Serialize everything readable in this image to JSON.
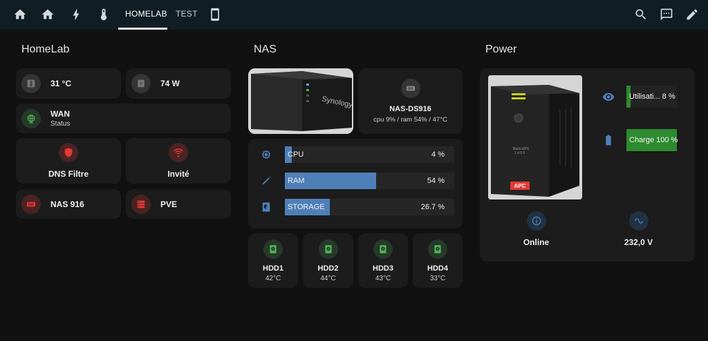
{
  "nav": {
    "tabs": [
      {
        "icon": "home-icon"
      },
      {
        "icon": "home-icon"
      },
      {
        "icon": "lightning-icon"
      },
      {
        "icon": "thermometer-icon"
      },
      {
        "label": "HOMELAB",
        "active": true
      },
      {
        "label": "TEST"
      },
      {
        "icon": "tablet-icon"
      }
    ],
    "actions": [
      "search-icon",
      "chat-icon",
      "edit-icon"
    ]
  },
  "homelab": {
    "title": "HomeLab",
    "temperature": "31 °C",
    "power": "74 W",
    "wan": {
      "name": "WAN",
      "status": "Status"
    },
    "dns": "DNS Filtre",
    "guest": "Invité",
    "nas": "NAS 916",
    "pve": "PVE"
  },
  "nas": {
    "title": "NAS",
    "device_name": "NAS-DS916",
    "device_stats": "cpu 9% / ram 54% / 47°C",
    "brand": "Synology",
    "bars": [
      {
        "label": "CPU",
        "value": 4,
        "display": "4 %"
      },
      {
        "label": "RAM",
        "value": 54,
        "display": "54 %"
      },
      {
        "label": "STORAGE",
        "value": 26.7,
        "display": "26.7 %"
      }
    ],
    "disks": [
      {
        "name": "HDD1",
        "temp": "42°C"
      },
      {
        "name": "HDD2",
        "temp": "44°C"
      },
      {
        "name": "HDD3",
        "temp": "43°C"
      },
      {
        "name": "HDD4",
        "temp": "33°C"
      }
    ]
  },
  "power": {
    "title": "Power",
    "brand": "APC",
    "utilisation": {
      "label": "Utilisati... 8 %",
      "value": 8
    },
    "charge": {
      "label": "Charge 100 %",
      "value": 100
    },
    "status": "Online",
    "voltage": "232,0 V"
  },
  "colors": {
    "accent_blue": "#4f7fb8",
    "ok_green": "#2e8a2e",
    "alert_red": "#e53935"
  }
}
